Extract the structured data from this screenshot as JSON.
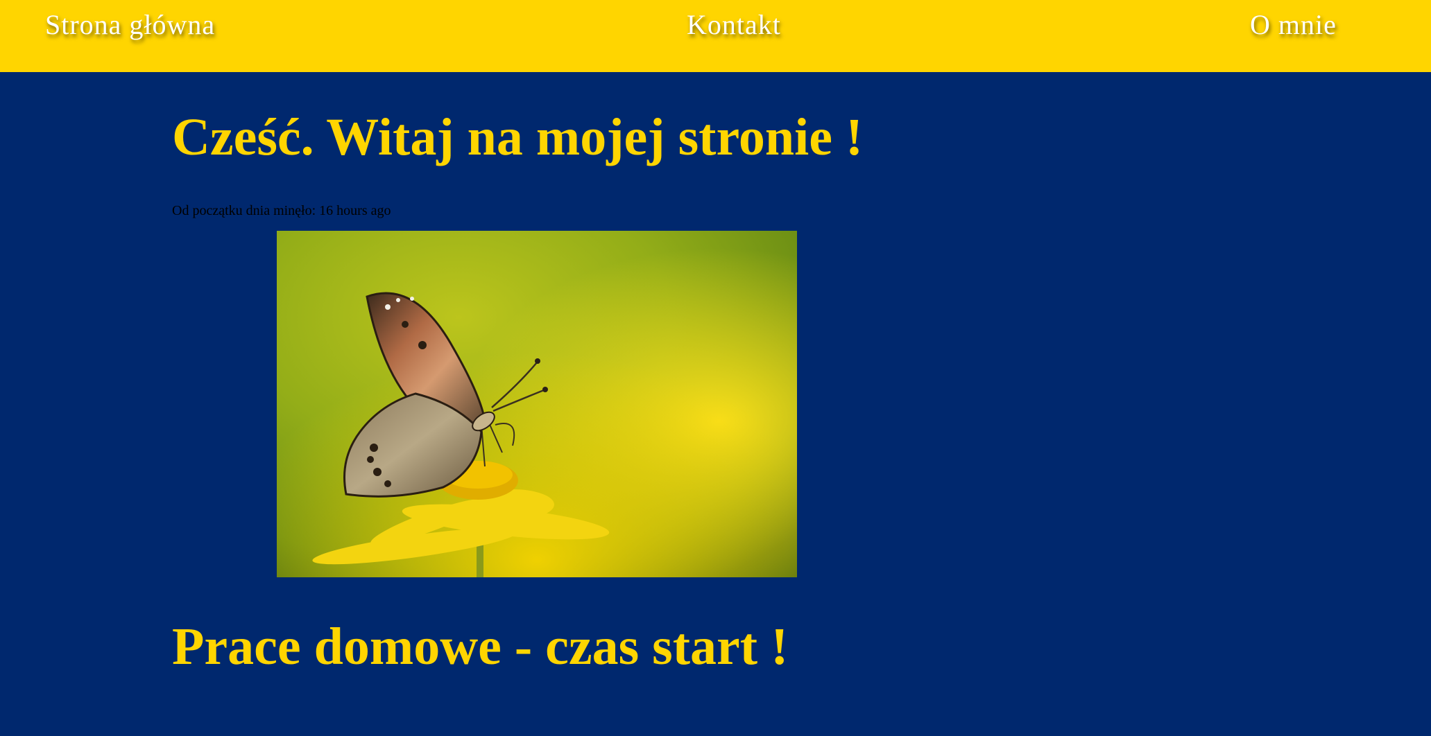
{
  "nav": {
    "home_label": "Strona główna",
    "contact_label": "Kontakt",
    "about_label": "O mnie"
  },
  "main": {
    "welcome_heading": "Cześć. Witaj na mojej stronie !",
    "since_label": "Od początku dnia minęło: 16 hours ago",
    "image_description_icon": "butterfly-on-flower",
    "homework_heading": "Prace domowe - czas start !"
  },
  "colors": {
    "header_bg": "#ffd500",
    "page_bg": "#00286e",
    "heading_text": "#ffd500",
    "nav_text": "#ffffff"
  }
}
